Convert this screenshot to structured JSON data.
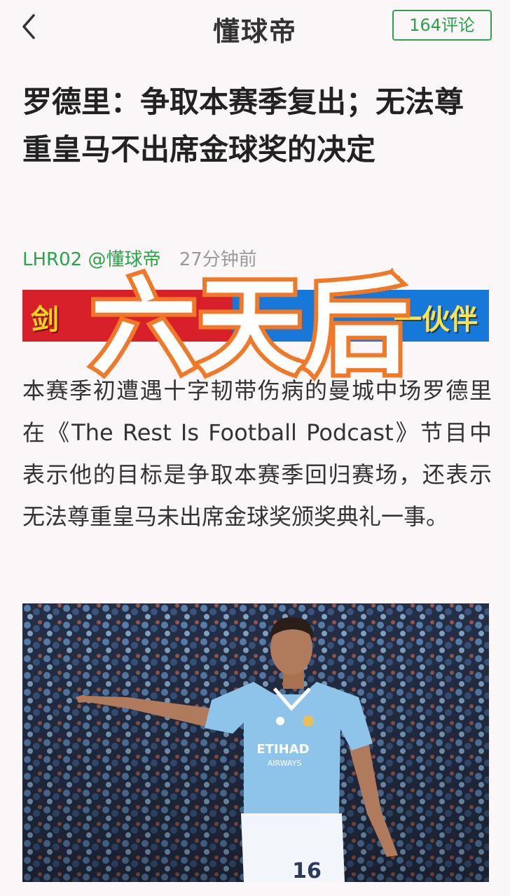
{
  "header": {
    "brand": "懂球帝",
    "comments_label": "164评论"
  },
  "article": {
    "title": "罗德里：争取本赛季复出；无法尊重皇马不出席金球奖的决定",
    "author": "LHR02 @懂球帝",
    "time": "27分钟前",
    "body": "本赛季初遭遇十字韧带伤病的曼城中场罗德里在《The Rest Is Football Podcast》节目中表示他的目标是争取本赛季回归赛场，还表示无法尊重皇马未出席金球奖颁奖典礼一事。"
  },
  "banner": {
    "left_text": "剑",
    "right_text": "一伙伴"
  },
  "overlay_text": "六天后",
  "photo": {
    "jersey_sponsor": "ETIHAD",
    "jersey_sub": "AIRWAYS",
    "shirt_number": "16"
  },
  "colors": {
    "accent_green": "#2aa34a",
    "overlay_orange": "#f07826",
    "jersey_blue": "#8ec3ea"
  }
}
